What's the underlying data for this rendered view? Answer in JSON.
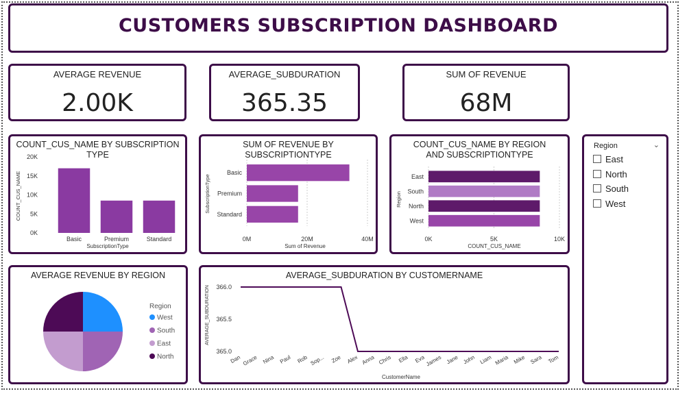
{
  "dashboard": {
    "title": "CUSTOMERS SUBSCRIPTION DASHBOARD"
  },
  "kpis": [
    {
      "label": "AVERAGE REVENUE",
      "value": "2.00K"
    },
    {
      "label": "AVERAGE_SUBDURATION",
      "value": "365.35"
    },
    {
      "label": "SUM OF REVENUE",
      "value": "68M"
    }
  ],
  "colors": {
    "frame": "#3d0d48",
    "purple": "#8a3aa1",
    "purple_mid": "#9845a8",
    "purple_dark": "#5e1a6a",
    "purple_light": "#b07bc5",
    "west": "#1e90ff",
    "south": "#a064b4",
    "east": "#c39ccf",
    "north": "#4d0a56"
  },
  "slicer": {
    "title": "Region",
    "options": [
      "East",
      "North",
      "South",
      "West"
    ]
  },
  "chart_data": [
    {
      "type": "bar",
      "title": "COUNT_CUS_NAME BY SUBSCRIPTION TYPE",
      "categories": [
        "Basic",
        "Premium",
        "Standard"
      ],
      "values": [
        17000,
        8500,
        8500
      ],
      "xlabel": "SubscriptionType",
      "ylabel": "COUNT_CUS_NAME",
      "ylim": [
        0,
        20000
      ],
      "yticks": [
        "0K",
        "5K",
        "10K",
        "15K",
        "20K"
      ]
    },
    {
      "type": "bar",
      "orientation": "horizontal",
      "title": "SUM OF REVENUE BY SUBSCRIPTIONTYPE",
      "categories": [
        "Basic",
        "Premium",
        "Standard"
      ],
      "values": [
        34000000,
        17000000,
        17000000
      ],
      "xlabel": "Sum of Revenue",
      "ylabel": "SubscriptionType",
      "xlim": [
        0,
        40000000
      ],
      "xticks": [
        "0M",
        "20M",
        "40M"
      ],
      "grid": true
    },
    {
      "type": "bar",
      "orientation": "horizontal",
      "title": "COUNT_CUS_NAME BY REGION AND SUBSCRIPTIONTYPE",
      "categories": [
        "East",
        "South",
        "North",
        "West"
      ],
      "values": [
        8500,
        8500,
        8500,
        8500
      ],
      "xlabel": "COUNT_CUS_NAME",
      "ylabel": "Region",
      "xlim": [
        0,
        10000
      ],
      "xticks": [
        "0K",
        "5K",
        "10K"
      ],
      "grid": true
    },
    {
      "type": "pie",
      "title": "AVERAGE REVENUE BY REGION",
      "legend_title": "Region",
      "categories": [
        "West",
        "South",
        "East",
        "North"
      ],
      "values": [
        25,
        25,
        25,
        25
      ],
      "legend_placement": "right"
    },
    {
      "type": "line",
      "title": "AVERAGE_SUBDURATION BY CUSTOMERNAME",
      "x": [
        "Dan",
        "Grace",
        "Nina",
        "Paul",
        "Rob",
        "Sop...",
        "Zoe",
        "Alex",
        "Anna",
        "Chris",
        "Ella",
        "Eva",
        "James",
        "Jane",
        "John",
        "Liam",
        "Maria",
        "Mike",
        "Sara",
        "Tom"
      ],
      "values": [
        366.0,
        366.0,
        366.0,
        366.0,
        366.0,
        366.0,
        366.0,
        365.0,
        365.0,
        365.0,
        365.0,
        365.0,
        365.0,
        365.0,
        365.0,
        365.0,
        365.0,
        365.0,
        365.0,
        365.0
      ],
      "xlabel": "CustomerName",
      "ylabel": "AVERAGE_SUBDURATION",
      "ylim": [
        365.0,
        366.0
      ],
      "yticks": [
        "365.0",
        "365.5",
        "366.0"
      ]
    }
  ]
}
